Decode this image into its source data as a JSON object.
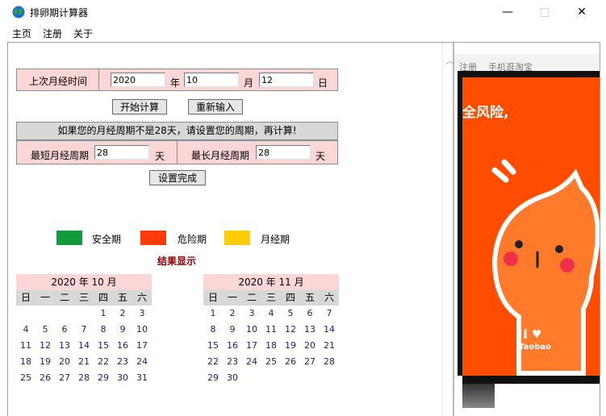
{
  "window": {
    "title": "排卵期计算器",
    "minimize": "—",
    "maximize": "□",
    "close": "✕"
  },
  "menu": [
    "主页",
    "注册",
    "关于"
  ],
  "form": {
    "last_period_label": "上次月经时间",
    "year_value": "2020",
    "year_unit": "年",
    "month_value": "10",
    "month_unit": "月",
    "day_value": "12",
    "day_unit": "日",
    "start_button": "开始计算",
    "reset_button": "重新输入",
    "notice": "如果您的月经周期不是28天，请设置您的周期，再计算!",
    "min_cycle_label": "最短月经周期",
    "min_cycle_value": "28",
    "min_cycle_unit": "天",
    "max_cycle_label": "最长月经周期",
    "max_cycle_value": "28",
    "max_cycle_unit": "天",
    "done_button": "设置完成"
  },
  "legend": [
    {
      "label": "安全期",
      "color": "#149a3c"
    },
    {
      "label": "危险期",
      "color": "#ff3a0a"
    },
    {
      "label": "月经期",
      "color": "#ffcc0a"
    }
  ],
  "result_title": "结果显示",
  "weekdays": [
    "日",
    "一",
    "二",
    "三",
    "四",
    "五",
    "六"
  ],
  "calendars": [
    {
      "title": "2020 年 10 月",
      "days": [
        "",
        "",
        "",
        "",
        "1",
        "2",
        "3",
        "4",
        "5",
        "6",
        "7",
        "8",
        "9",
        "10",
        "11",
        "12",
        "13",
        "14",
        "15",
        "16",
        "17",
        "18",
        "19",
        "20",
        "21",
        "22",
        "23",
        "24",
        "25",
        "26",
        "27",
        "28",
        "29",
        "30",
        "31"
      ]
    },
    {
      "title": "2020 年 11 月",
      "days": [
        "1",
        "2",
        "3",
        "4",
        "5",
        "6",
        "7",
        "8",
        "9",
        "10",
        "11",
        "12",
        "13",
        "14",
        "15",
        "16",
        "17",
        "18",
        "19",
        "20",
        "21",
        "22",
        "23",
        "24",
        "25",
        "26",
        "27",
        "28",
        "29",
        "30"
      ]
    }
  ],
  "ad": {
    "nav": "注册    手机逛淘宝",
    "slogan": "全风险,",
    "brand_i": "I",
    "brand_name": "Taobao",
    "bg_color": "#ff4d00"
  }
}
